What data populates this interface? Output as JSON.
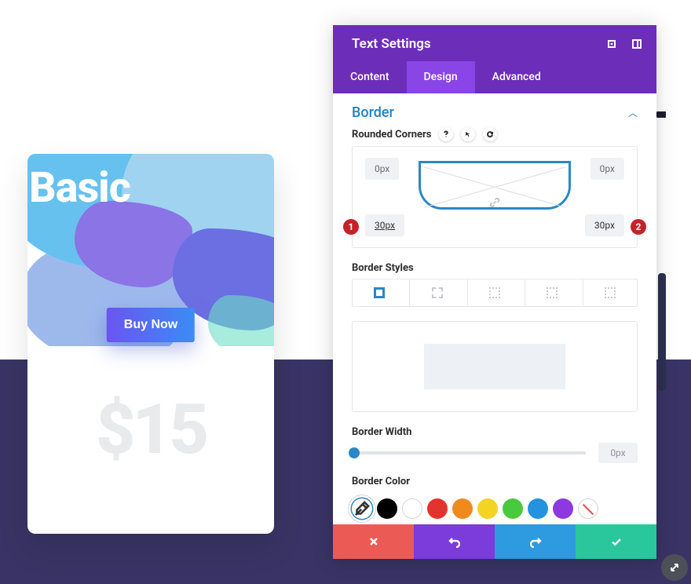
{
  "card": {
    "title": "Basic",
    "buy_label": "Buy Now",
    "price": "$15"
  },
  "panel": {
    "title": "Text Settings",
    "tabs": {
      "content": "Content",
      "design": "Design",
      "advanced": "Advanced"
    },
    "section": {
      "border": "Border"
    },
    "rounded": {
      "label": "Rounded Corners",
      "tl": "0px",
      "tr": "0px",
      "bl": "30px",
      "br": "30px"
    },
    "annotations": {
      "badge1": "1",
      "badge2": "2"
    },
    "border_styles": {
      "label": "Border Styles"
    },
    "border_width": {
      "label": "Border Width",
      "value": "0px"
    },
    "border_color": {
      "label": "Border Color"
    },
    "colors": {
      "palette": [
        "#000000",
        "#ffffff",
        "#e3332c",
        "#f08a1c",
        "#f3d324",
        "#49c93d",
        "#2392df",
        "#8c3ae0"
      ]
    }
  }
}
